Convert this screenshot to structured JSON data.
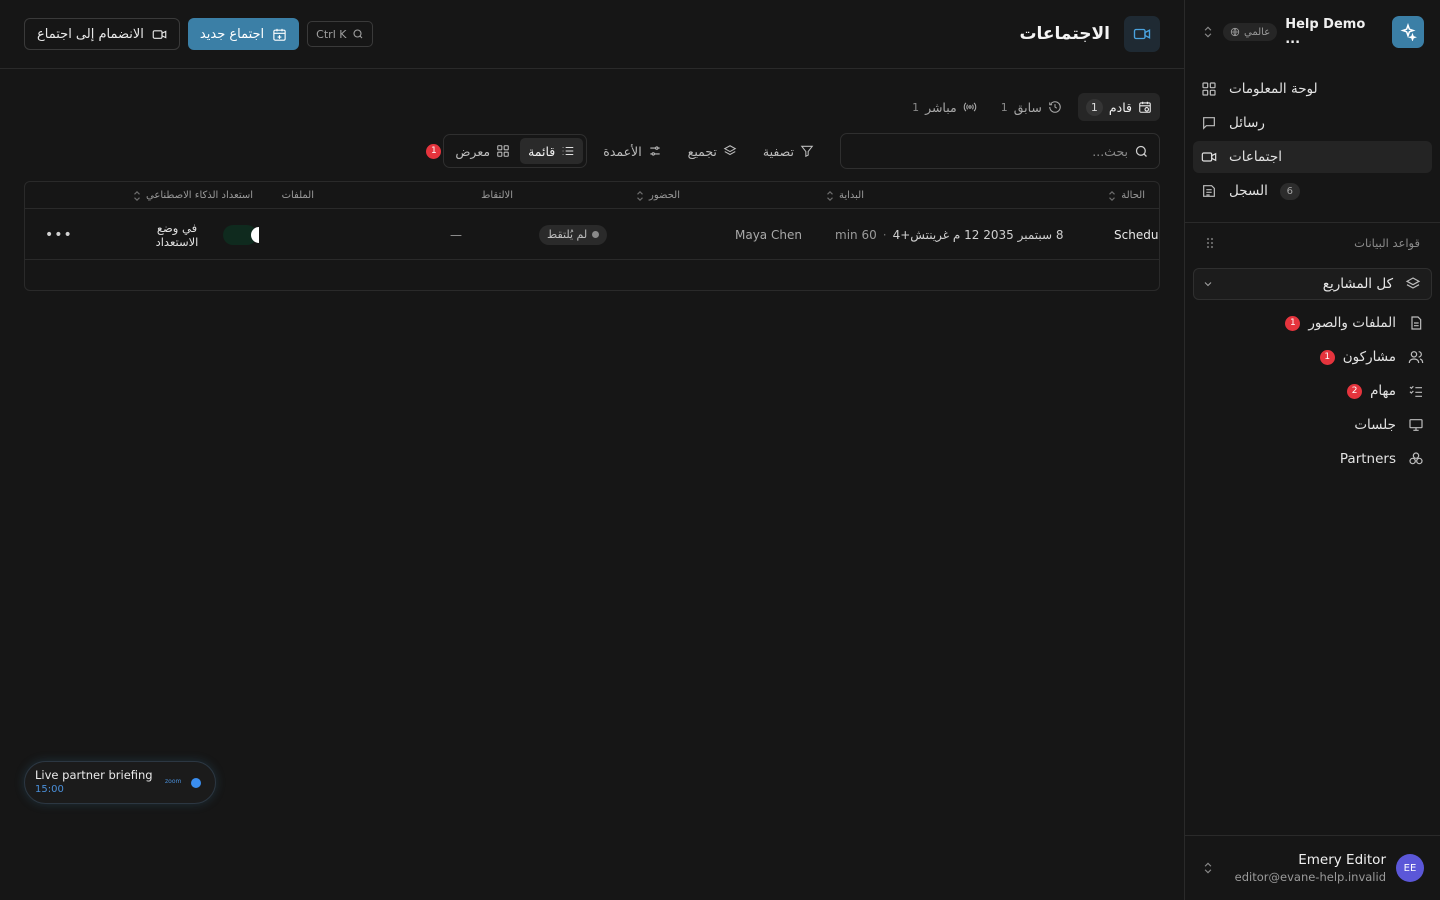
{
  "workspace": {
    "name": "Help Demo ...",
    "badge": "عالمي"
  },
  "nav": {
    "items": [
      {
        "label": "لوحة المعلومات",
        "icon": "dashboard-icon"
      },
      {
        "label": "رسائل",
        "icon": "message-icon"
      },
      {
        "label": "اجتماعات",
        "icon": "video-icon",
        "active": true
      },
      {
        "label": "السجل",
        "icon": "log-icon",
        "count": "6"
      }
    ]
  },
  "databases": {
    "title": "قواعد البيانات",
    "project_selector": "كل المشاريع",
    "items": [
      {
        "label": "الملفات والصور",
        "badge": "1"
      },
      {
        "label": "مشاركون",
        "badge": "1"
      },
      {
        "label": "مهام",
        "badge": "2"
      },
      {
        "label": "جلسات"
      },
      {
        "label": "Partners"
      }
    ]
  },
  "user": {
    "name": "Emery Editor",
    "email": "editor@evane-help.invalid",
    "initials": "EE"
  },
  "header": {
    "title": "الاجتماعات",
    "shortcut": "Ctrl K",
    "new_meeting": "اجتماع جديد",
    "join_meeting": "الانضمام إلى اجتماع"
  },
  "tabs": [
    {
      "label": "قادم",
      "count": "1",
      "active": true
    },
    {
      "label": "سابق",
      "count": "1"
    },
    {
      "label": "مباشر",
      "count": "1"
    }
  ],
  "toolbar": {
    "search_placeholder": "بحث...",
    "filter": "تصفية",
    "group": "تجميع",
    "columns": "الأعمدة",
    "view_list": "قائمة",
    "view_gallery": "معرض",
    "alert_count": "1"
  },
  "table": {
    "headers": {
      "status": "الحالة",
      "start": "البداية",
      "attendance": "الحضور",
      "capture": "الالتقاط",
      "files": "الملفات",
      "ai_ready": "استعداد الذكاء الاصطناعي"
    },
    "rows": [
      {
        "status": "Scheduled",
        "start_date": "8 سبتمبر 2035 12 م غرينتش+4",
        "duration": "60 min",
        "attendee": "Maya Chen",
        "capture": "لم يُلتقط",
        "files": "—",
        "ai_ready_label": "في وضع الاستعداد"
      }
    ]
  },
  "live_widget": {
    "title": "Live partner briefing",
    "time": "15:00",
    "provider": "zoom"
  },
  "colors": {
    "accent": "#3b7fa6",
    "danger": "#e5343d",
    "background": "#161616"
  }
}
